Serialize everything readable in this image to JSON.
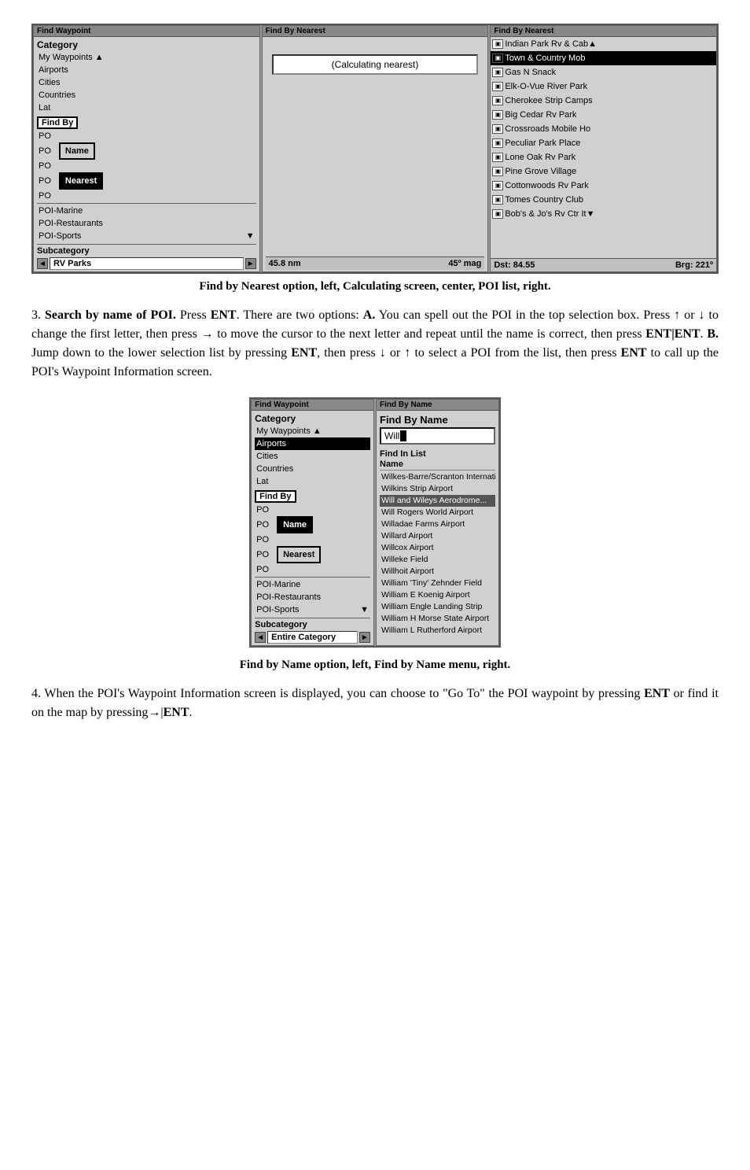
{
  "top_screenshot": {
    "panel1": {
      "title": "Find Waypoint",
      "category_label": "Category",
      "items": [
        "My Waypoints",
        "Airports",
        "Cities",
        "Countries",
        "Lat"
      ],
      "find_by_label": "Find By",
      "po_items": [
        "PO",
        "PO",
        "PO",
        "PO",
        "PO"
      ],
      "name_btn": "Name",
      "nearest_btn": "Nearest",
      "poi_items": [
        "POI-Marine",
        "POI-Restaurants",
        "POI-Sports"
      ],
      "subcategory_label": "Subcategory",
      "subcategory_value": "RV Parks"
    },
    "panel2": {
      "title": "Find By Nearest",
      "calculating": "(Calculating nearest)",
      "distance": "45.8 nm",
      "bearing": "45º mag"
    },
    "panel3": {
      "title": "Find By Nearest",
      "items": [
        "Indian Park Rv & Cab",
        "Town & Country Mob",
        "Gas N Snack",
        "Elk-O-Vue River Park",
        "Cherokee Strip Camps",
        "Big Cedar Rv Park",
        "Crossroads Mobile Ho",
        "Peculiar Park Place",
        "Lone Oak Rv Park",
        "Pine Grove Village",
        "Cottonwoods Rv Park",
        "Tomes Country Club",
        "Bob's & Jo's Rv Ctr It"
      ],
      "selected_index": 1,
      "dst": "Dst: 84.55",
      "brg": "Brg: 221º"
    }
  },
  "caption1": "Find by Nearest option, left, Calculating screen, center, POI list, right.",
  "paragraph3": {
    "number": "3.",
    "intro": "Search by name of POI.",
    "press": "Press",
    "ent": "ENT",
    "text1": ". There are two options:",
    "a_label": "A.",
    "text2": "You can spell out the POI in the top selection box. Press ↑ or ↓ to change the first letter, then press → to move the cursor to the next letter and repeat until the name is correct, then press",
    "ent2": "ENT|ENT",
    "text3": ".",
    "b_label": "B.",
    "text4": "Jump down to the lower selection list by pressing",
    "ent3": "ENT",
    "text5": ", then press ↓ or ↑ to select a POI from the list, then press",
    "ent4": "ENT",
    "text6": "to call up the POI's Waypoint Information screen."
  },
  "bottom_screenshot": {
    "panel1": {
      "title": "Find Waypoint",
      "category_label": "Category",
      "items": [
        "My Waypoints",
        "Airports",
        "Cities",
        "Countries",
        "Lat"
      ],
      "find_by_label": "Find By",
      "po_items": [
        "PO",
        "PO",
        "PO",
        "PO",
        "PO"
      ],
      "name_btn": "Name",
      "nearest_btn": "Nearest",
      "poi_items": [
        "POI-Marine",
        "POI-Restaurants",
        "POI-Sports"
      ],
      "subcategory_label": "Subcategory",
      "subcategory_value": "Entire Category"
    },
    "panel2": {
      "title": "Find By Name",
      "find_by_name_label": "Find By Name",
      "input_value": "Will",
      "find_in_list": "Find In List",
      "name_col": "Name",
      "list_items": [
        "Wilkes-Barre/Scranton International",
        "Wilkins Strip Airport",
        "Will and Wileys Aerodrome...",
        "Will Rogers World Airport",
        "Willadae Farms Airport",
        "Willard Airport",
        "Willcox Airport",
        "Willeke Field",
        "Willhoit Airport",
        "William 'Tiny' Zehnder Field",
        "William E Koenig Airport",
        "William Engle Landing Strip",
        "William H Morse State Airport",
        "William L Rutherford Airport"
      ],
      "selected_index": 2
    }
  },
  "caption2": "Find by Name option, left, Find by Name menu, right.",
  "paragraph4": {
    "number": "4.",
    "text": "When the POI's Waypoint Information screen is displayed, you can choose to \"Go To\" the POI waypoint by pressing",
    "ent": "ENT",
    "text2": "or find it on the map by pressing→|",
    "ent2": "ENT",
    "end": "."
  }
}
